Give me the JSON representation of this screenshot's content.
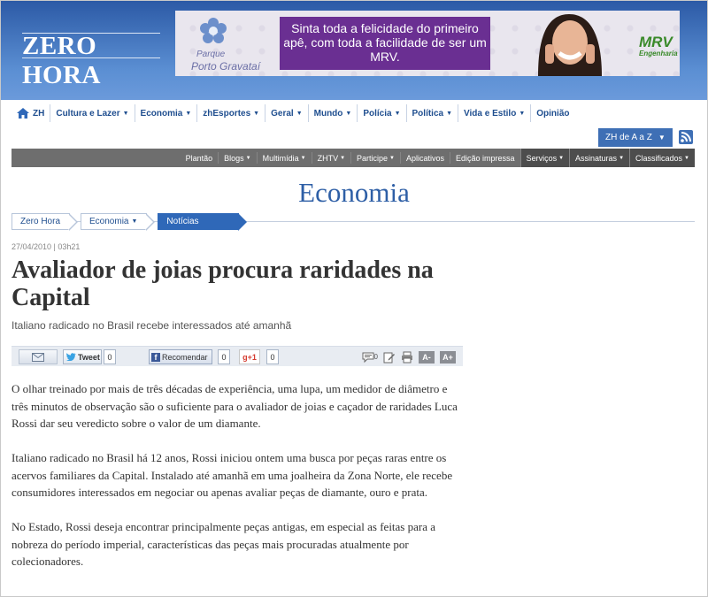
{
  "site": {
    "logo": "ZERO HORA"
  },
  "ad": {
    "brand_small": "Parque",
    "brand_name": "Porto Gravataí",
    "text": "Sinta toda a felicidade do primeiro apê, com toda a facilidade de ser um MRV.",
    "advertiser": "MRV",
    "advertiser_sub": "Engenharia",
    "colors": {
      "box": "#6a2f92",
      "advertiser": "#3a8a2a"
    }
  },
  "nav": {
    "items": [
      {
        "label": "ZH",
        "icon": "home-icon",
        "dropdown": false
      },
      {
        "label": "Cultura e Lazer",
        "dropdown": true
      },
      {
        "label": "Economia",
        "dropdown": true
      },
      {
        "label": "zhEsportes",
        "dropdown": true
      },
      {
        "label": "Geral",
        "dropdown": true
      },
      {
        "label": "Mundo",
        "dropdown": true
      },
      {
        "label": "Polícia",
        "dropdown": true
      },
      {
        "label": "Política",
        "dropdown": true
      },
      {
        "label": "Vida e Estilo",
        "dropdown": true
      },
      {
        "label": "Opinião",
        "dropdown": false
      }
    ],
    "az_label": "ZH de A a Z"
  },
  "subnav": {
    "items": [
      {
        "label": "Plantão",
        "dropdown": false,
        "dark": false
      },
      {
        "label": "Blogs",
        "dropdown": true,
        "dark": false
      },
      {
        "label": "Multimídia",
        "dropdown": true,
        "dark": false
      },
      {
        "label": "ZHTV",
        "dropdown": true,
        "dark": false
      },
      {
        "label": "Participe",
        "dropdown": true,
        "dark": false
      },
      {
        "label": "Aplicativos",
        "dropdown": false,
        "dark": false
      },
      {
        "label": "Edição impressa",
        "dropdown": false,
        "dark": false
      },
      {
        "label": "Serviços",
        "dropdown": true,
        "dark": true
      },
      {
        "label": "Assinaturas",
        "dropdown": true,
        "dark": true
      },
      {
        "label": "Classificados",
        "dropdown": true,
        "dark": true
      }
    ]
  },
  "section_title": "Economia",
  "breadcrumb": [
    {
      "label": "Zero Hora",
      "dropdown": false
    },
    {
      "label": "Economia",
      "dropdown": true
    },
    {
      "label": "Notícias",
      "dropdown": false
    }
  ],
  "article": {
    "date": "27/04/2010 | 03h21",
    "title": "Avaliador de joias procura raridades na Capital",
    "subtitle": "Italiano radicado no Brasil recebe interessados até amanhã",
    "paragraphs": [
      "O olhar treinado por mais de três décadas de experiência, uma lupa, um medidor de diâmetro e três minutos de observação são o suficiente para o avaliador de joias e caçador de raridades Luca Rossi dar seu veredicto sobre o valor de um diamante.",
      "Italiano radicado no Brasil há 12 anos, Rossi iniciou ontem uma busca por peças raras entre os acervos familiares da Capital. Instalado até amanhã em uma joalheira da Zona Norte, ele recebe consumidores interessados em negociar ou apenas avaliar peças de diamante, ouro e prata.",
      "No Estado, Rossi deseja encontrar principalmente peças antigas, em especial as feitas para a nobreza do período imperial, características das peças mais procuradas atualmente por colecionadores."
    ]
  },
  "share": {
    "tweet_label": "Tweet",
    "tweet_count": "0",
    "fb_label": "Recomendar",
    "fb_count": "0",
    "gplus_label": "g+1",
    "gplus_count": "0",
    "comments_count": "0",
    "font_decrease": "A-",
    "font_increase": "A+"
  },
  "colors": {
    "header": "#2c5aa6",
    "nav_text": "#1f4e8f",
    "section_title": "#2e5fa6",
    "subnav": "#6e6e6e"
  }
}
